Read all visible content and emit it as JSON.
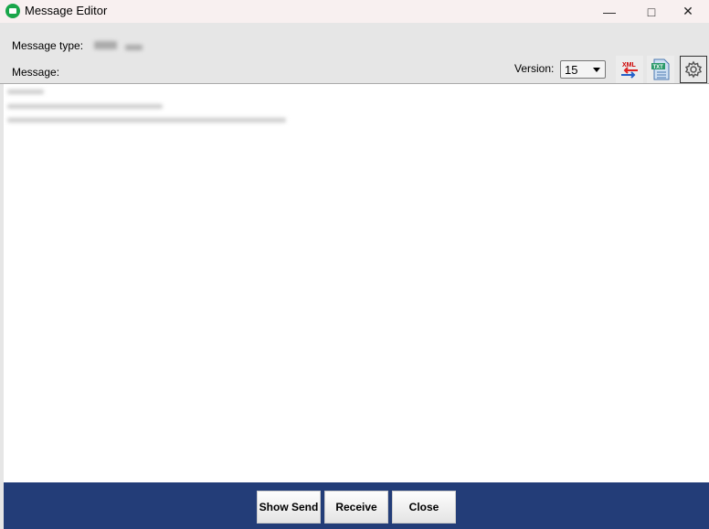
{
  "window": {
    "title": "Message Editor",
    "icon": "envelope-icon"
  },
  "header": {
    "message_type_label": "Message type:",
    "message_label": "Message:",
    "version_label": "Version:",
    "version_value": "15"
  },
  "toolbar": {
    "xml_icon_text": "XML",
    "txt_icon_text": "TXT"
  },
  "footer": {
    "show_send": "Show Send",
    "receive": "Receive",
    "close": "Close"
  }
}
